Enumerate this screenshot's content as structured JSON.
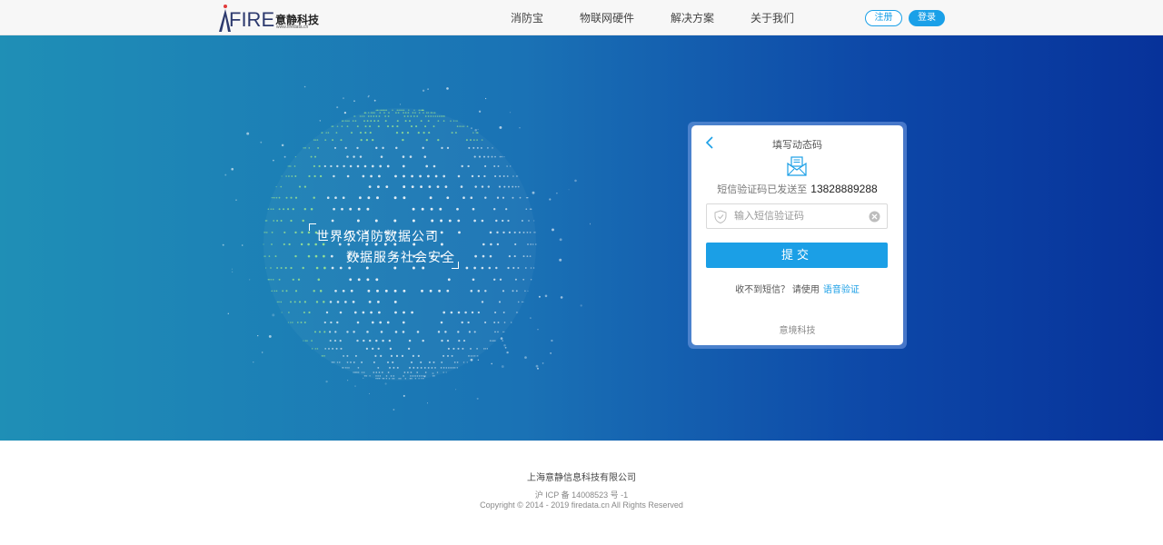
{
  "header": {
    "logo_text": "FIRE",
    "logo_cn": "意静科技",
    "logo_url": "www.firedata.cn",
    "nav": [
      {
        "label": "消防宝"
      },
      {
        "label": "物联网硬件"
      },
      {
        "label": "解决方案"
      },
      {
        "label": "关于我们"
      }
    ],
    "register_label": "注册",
    "login_label": "登录"
  },
  "hero": {
    "slogan_line1": "世界级消防数据公司",
    "slogan_line2": "数据服务社会安全"
  },
  "card": {
    "title": "填写动态码",
    "sent_prefix": "短信验证码已发送至",
    "phone": "13828889288",
    "code_placeholder": "输入短信验证码",
    "code_value": "",
    "submit_label": "提交",
    "no_sms_text": "收不到短信？ 请使用",
    "voice_link": "语音验证",
    "footer": "意境科技"
  },
  "footer": {
    "company": "上海意静信息科技有限公司",
    "icp": "沪 ICP 备 14008523 号 -1",
    "copyright": "Copyright © 2014 - 2019 firedata.cn All Rights Reserved"
  },
  "colors": {
    "accent": "#1b9fe6",
    "hero_left": "#1f8fb6",
    "hero_right": "#07329a"
  },
  "icons": {
    "back": "chevron-left-icon",
    "envelope": "envelope-icon",
    "shield": "shield-icon",
    "clear": "clear-icon"
  }
}
